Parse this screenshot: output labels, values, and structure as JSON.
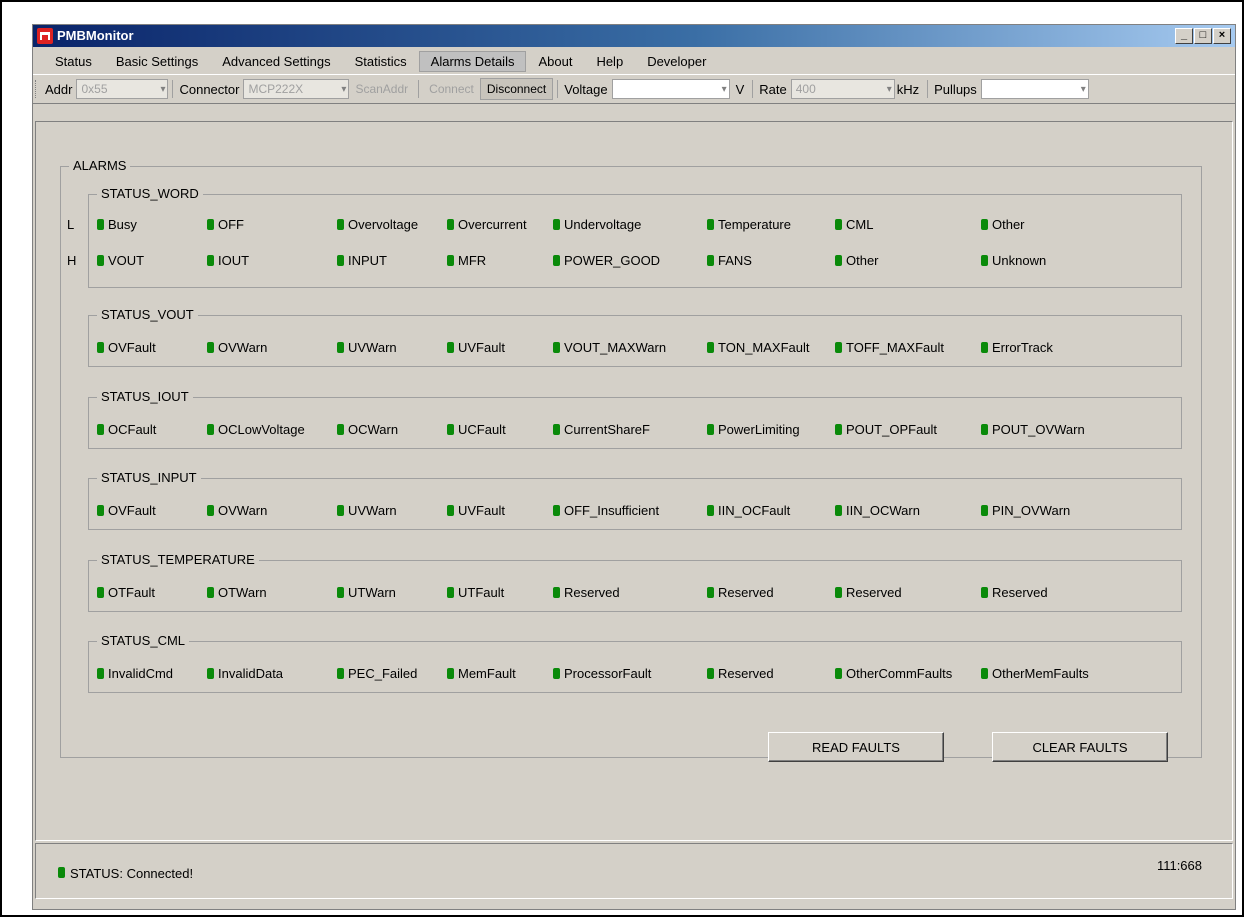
{
  "window": {
    "title": "PMBMonitor"
  },
  "menu": [
    "Status",
    "Basic Settings",
    "Advanced Settings",
    "Statistics",
    "Alarms Details",
    "About",
    "Help",
    "Developer"
  ],
  "menu_active_index": 4,
  "toolbar": {
    "addr_label": "Addr",
    "addr_value": "0x55",
    "connector_label": "Connector",
    "connector_value": "MCP222X",
    "scan_label": "ScanAddr",
    "connect_label": "Connect",
    "disconnect_label": "Disconnect",
    "voltage_label": "Voltage",
    "voltage_value": "",
    "voltage_unit": "V",
    "rate_label": "Rate",
    "rate_value": "400",
    "rate_unit": "kHz",
    "pullups_label": "Pullups",
    "pullups_value": ""
  },
  "alarms": {
    "title": "ALARMS",
    "row_labels": [
      "L",
      "H"
    ],
    "groups": [
      {
        "title": "STATUS_WORD",
        "rows": [
          [
            "Busy",
            "OFF",
            "Overvoltage",
            "Overcurrent",
            "Undervoltage",
            "Temperature",
            "CML",
            "Other"
          ],
          [
            "VOUT",
            "IOUT",
            "INPUT",
            "MFR",
            "POWER_GOOD",
            "FANS",
            "Other",
            "Unknown"
          ]
        ]
      },
      {
        "title": "STATUS_VOUT",
        "rows": [
          [
            "OVFault",
            "OVWarn",
            "UVWarn",
            "UVFault",
            "VOUT_MAXWarn",
            "TON_MAXFault",
            "TOFF_MAXFault",
            "ErrorTrack"
          ]
        ]
      },
      {
        "title": "STATUS_IOUT",
        "rows": [
          [
            "OCFault",
            "OCLowVoltage",
            "OCWarn",
            "UCFault",
            "CurrentShareF",
            "PowerLimiting",
            "POUT_OPFault",
            "POUT_OVWarn"
          ]
        ]
      },
      {
        "title": "STATUS_INPUT",
        "rows": [
          [
            "OVFault",
            "OVWarn",
            "UVWarn",
            "UVFault",
            "OFF_Insufficient",
            "IIN_OCFault",
            "IIN_OCWarn",
            "PIN_OVWarn"
          ]
        ]
      },
      {
        "title": "STATUS_TEMPERATURE",
        "rows": [
          [
            "OTFault",
            "OTWarn",
            "UTWarn",
            "UTFault",
            "Reserved",
            "Reserved",
            "Reserved",
            "Reserved"
          ]
        ]
      },
      {
        "title": "STATUS_CML",
        "rows": [
          [
            "InvalidCmd",
            "InvalidData",
            "PEC_Failed",
            "MemFault",
            "ProcessorFault",
            "Reserved",
            "OtherCommFaults",
            "OtherMemFaults"
          ]
        ]
      }
    ],
    "led_color": "#0a8a0a"
  },
  "buttons": {
    "read_faults": "READ FAULTS",
    "clear_faults": "CLEAR FAULTS"
  },
  "status": {
    "text": "STATUS: Connected!",
    "coords": "111:668"
  }
}
